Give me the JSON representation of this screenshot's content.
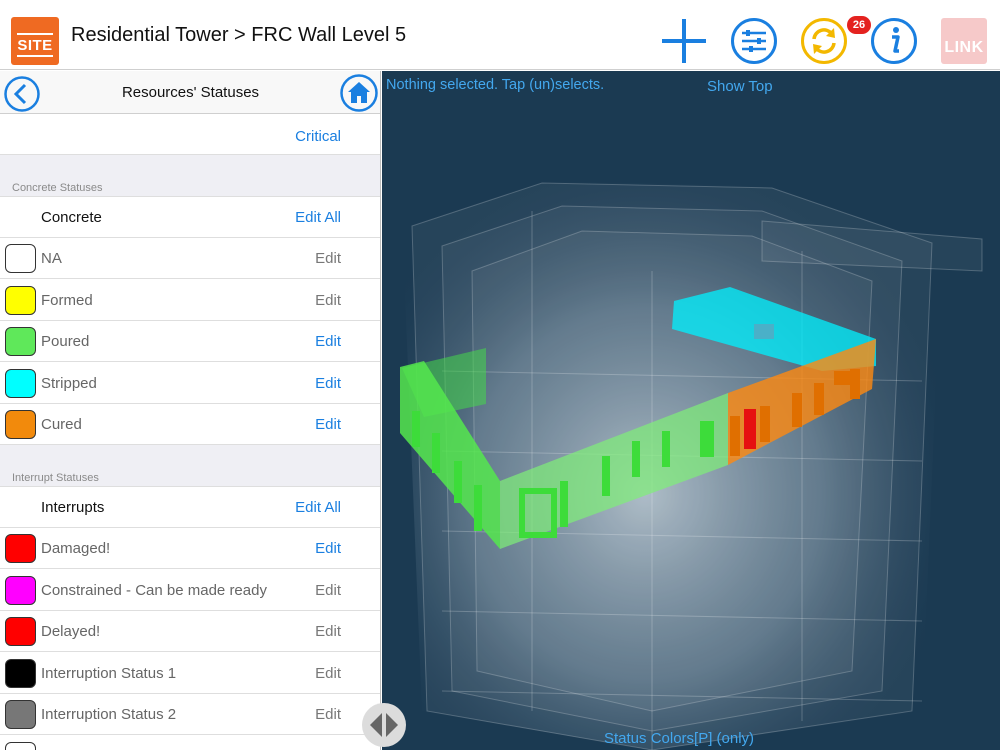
{
  "header": {
    "logo_text": "SITE",
    "title": "Residential Tower > FRC Wall Level 5",
    "sync_badge": "26",
    "link_logo_text": "LINK",
    "icons": [
      "plus-icon",
      "filter-sliders-icon",
      "sync-icon",
      "info-icon"
    ],
    "accent_color": "#1a7fe0",
    "sync_color": "#f3b800"
  },
  "panel": {
    "title": "Resources' Statuses",
    "critical_label": "Critical",
    "concrete_section": {
      "header": "Concrete Statuses",
      "group_label": "Concrete",
      "edit_all": "Edit All",
      "items": [
        {
          "label": "NA",
          "color": "#ffffff",
          "edit": "Edit",
          "edit_active": false
        },
        {
          "label": "Formed",
          "color": "#ffff00",
          "edit": "Edit",
          "edit_active": false
        },
        {
          "label": "Poured",
          "color": "#5fe85a",
          "edit": "Edit",
          "edit_active": true
        },
        {
          "label": "Stripped",
          "color": "#00ffff",
          "edit": "Edit",
          "edit_active": true
        },
        {
          "label": "Cured",
          "color": "#f28a0c",
          "edit": "Edit",
          "edit_active": true
        }
      ]
    },
    "interrupt_section": {
      "header": "Interrupt Statuses",
      "group_label": "Interrupts",
      "edit_all": "Edit All",
      "items": [
        {
          "label": "Damaged!",
          "color": "#ff0000",
          "edit": "Edit",
          "edit_active": true
        },
        {
          "label": "Constrained - Can be made ready",
          "color": "#ff00ff",
          "edit": "Edit",
          "edit_active": false
        },
        {
          "label": "Delayed!",
          "color": "#ff0000",
          "edit": "Edit",
          "edit_active": false
        },
        {
          "label": "Interruption Status 1",
          "color": "#000000",
          "edit": "Edit",
          "edit_active": false
        },
        {
          "label": "Interruption Status 2",
          "color": "#777777",
          "edit": "Edit",
          "edit_active": false
        }
      ]
    }
  },
  "viewport": {
    "status_text": "Nothing selected. Tap (un)selects.",
    "show_top": "Show Top",
    "footer": "Status Colors[P] (only)",
    "background_color": "#1b3a52"
  }
}
